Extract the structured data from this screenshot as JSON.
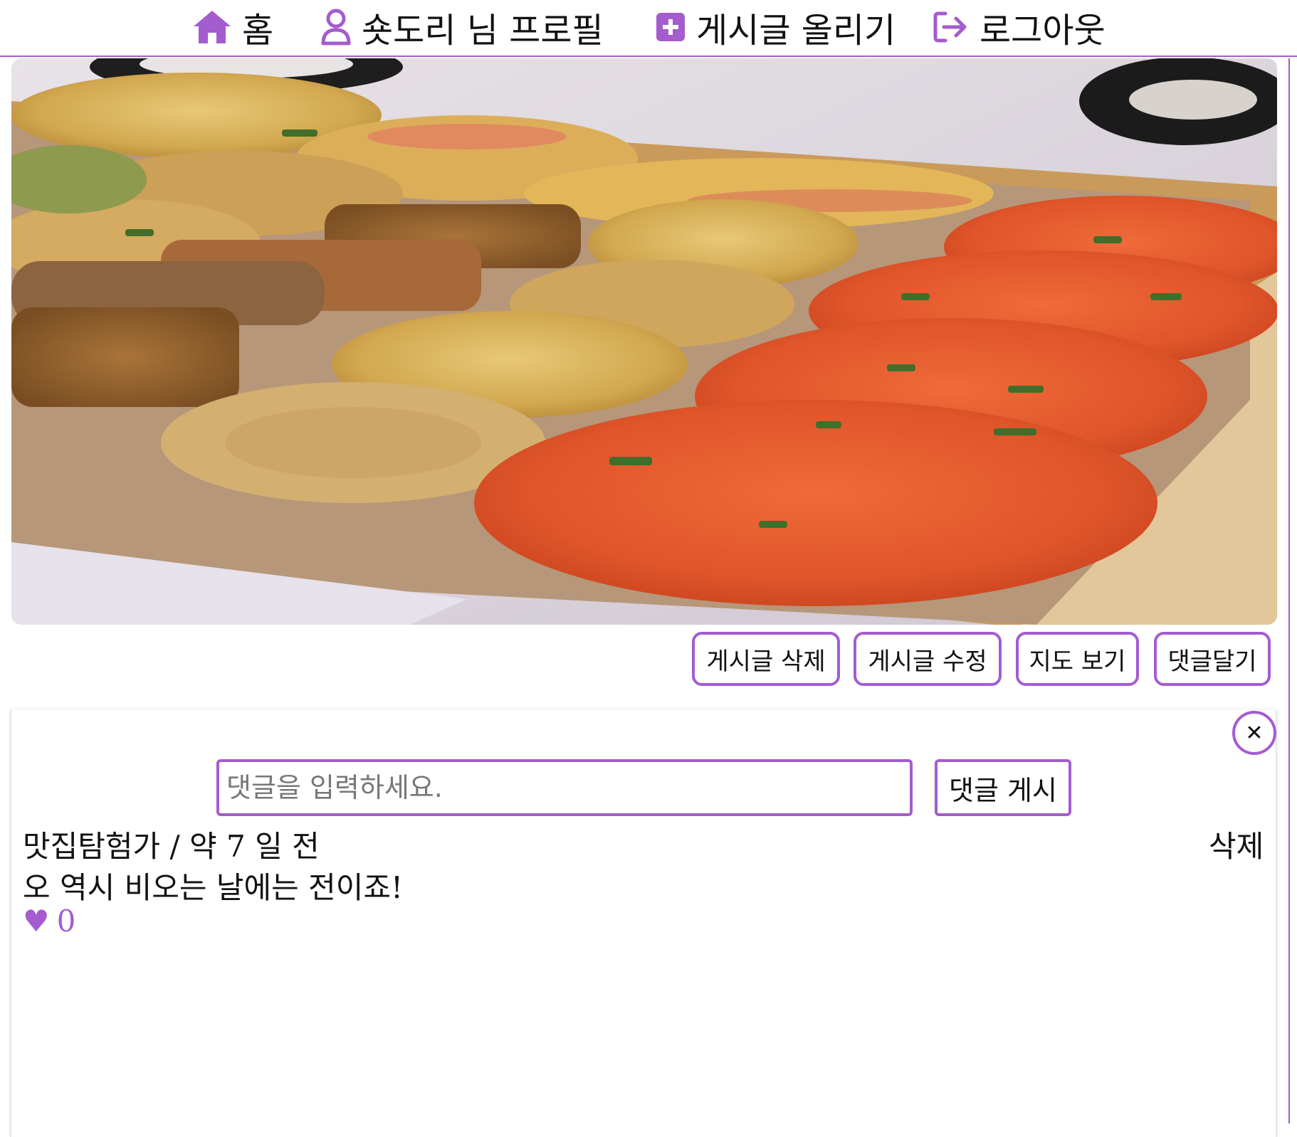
{
  "nav": {
    "home_label": "홈",
    "profile_label": "숏도리 님 프로필",
    "post_label": "게시글 올리기",
    "logout_label": "로그아웃"
  },
  "colors": {
    "accent": "#a45ccf",
    "text": "#111111"
  },
  "post": {
    "image_alt_icon": "food-photo"
  },
  "actions": {
    "delete_post": "게시글 삭제",
    "edit_post": "게시글 수정",
    "view_map": "지도 보기",
    "add_comment": "댓글달기"
  },
  "comment_form": {
    "placeholder": "댓글을 입력하세요.",
    "submit_label": "댓글 게시",
    "close_symbol": "✕"
  },
  "comments": [
    {
      "meta": "맛집탐험가 / 약 7 일 전",
      "text": "오 역시 비오는 날에는 전이죠!",
      "likes": "0",
      "delete_label": "삭제",
      "heart": "♥"
    }
  ]
}
